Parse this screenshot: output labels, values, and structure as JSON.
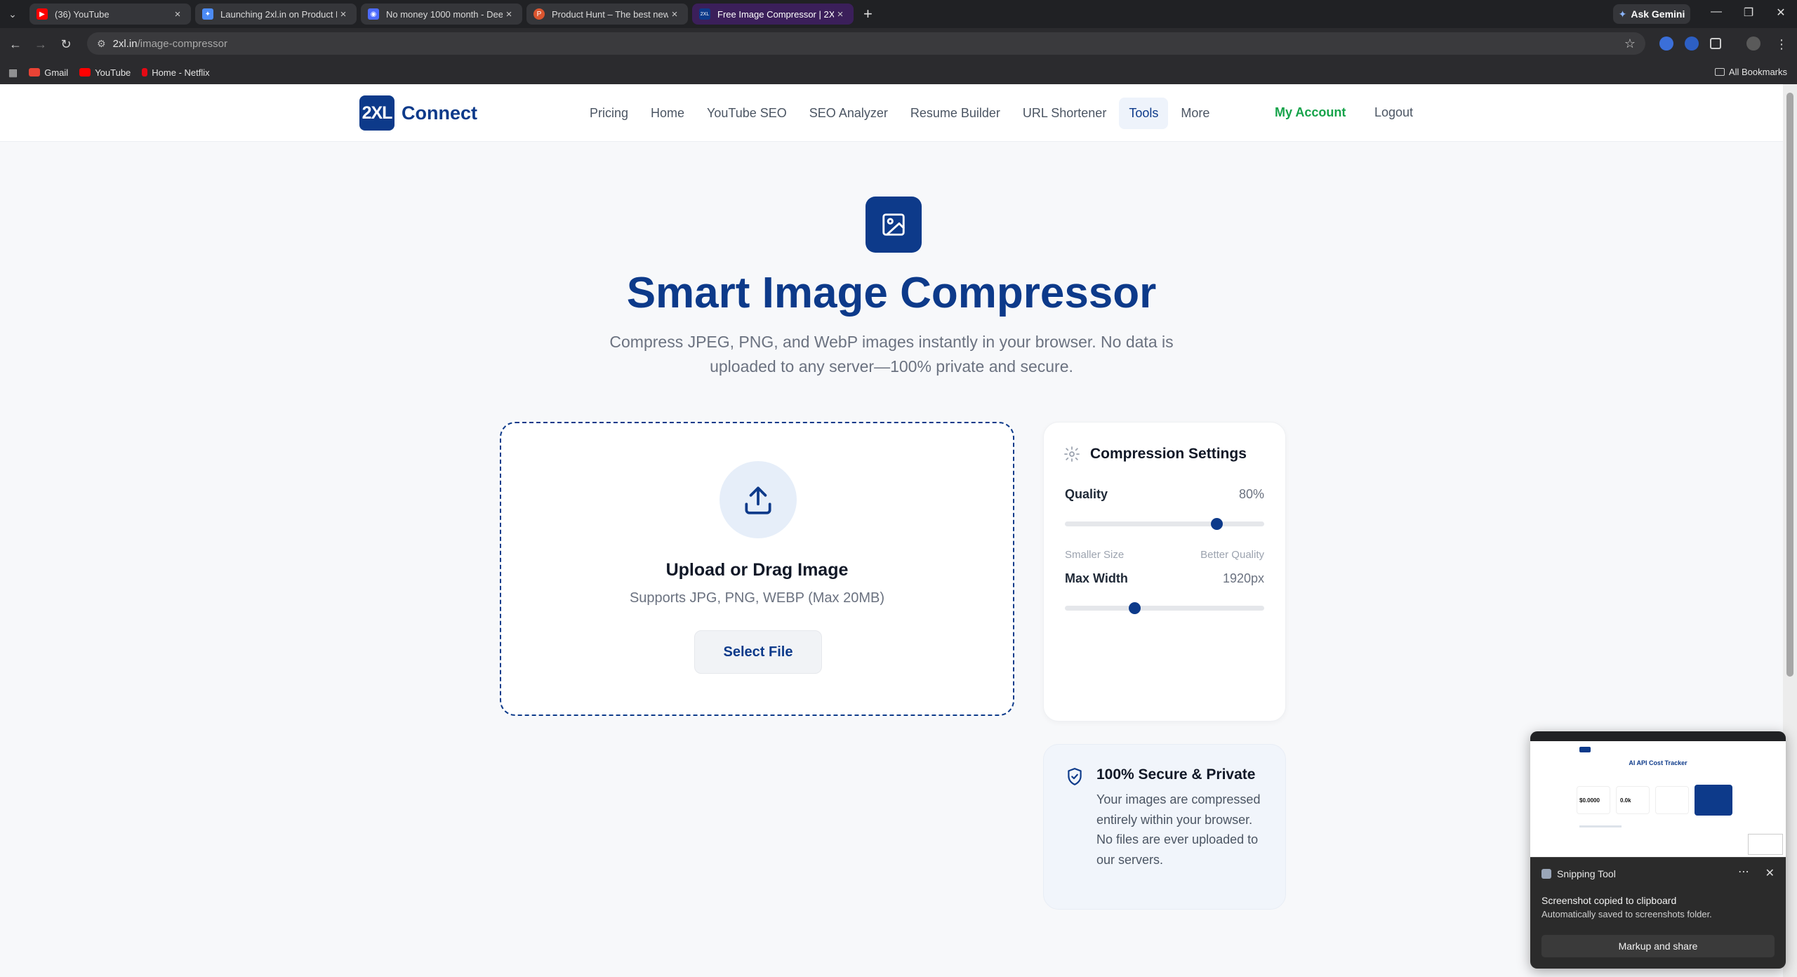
{
  "browser": {
    "tabs": [
      {
        "title": "(36) YouTube",
        "favicon_color": "#ff0000",
        "active": false
      },
      {
        "title": "Launching 2xl.in on Product Hu",
        "favicon_color": "#4c8bf5",
        "active": false
      },
      {
        "title": "No money 1000 month - Deep",
        "favicon_color": "#4d6bfe",
        "active": false
      },
      {
        "title": "Product Hunt – The best new p",
        "favicon_color": "#da552f",
        "active": false
      },
      {
        "title": "Free Image Compressor | 2XL",
        "favicon_color": "#0d3a8a",
        "active": true
      }
    ],
    "ask_gemini": "Ask Gemini",
    "url_host": "2xl.in",
    "url_path": "/image-compressor",
    "bookmarks": [
      {
        "label": "Gmail",
        "color": "#ea4335"
      },
      {
        "label": "YouTube",
        "color": "#ff0000"
      },
      {
        "label": "Home - Netflix",
        "color": "#e50914"
      }
    ],
    "all_bookmarks": "All Bookmarks"
  },
  "site": {
    "logo_badge": "2XL",
    "logo_text": "Connect",
    "nav": [
      "Pricing",
      "Home",
      "YouTube SEO",
      "SEO Analyzer",
      "Resume Builder",
      "URL Shortener",
      "Tools",
      "More"
    ],
    "active_nav": "Tools",
    "my_account": "My Account",
    "logout": "Logout"
  },
  "hero": {
    "icon": "image-icon",
    "title": "Smart Image Compressor",
    "subtitle": "Compress JPEG, PNG, and WebP images instantly in your browser. No data is uploaded to any server—100% private and secure."
  },
  "upload": {
    "icon": "upload-icon",
    "title": "Upload or Drag Image",
    "subtitle": "Supports JPG, PNG, WEBP (Max 20MB)",
    "button": "Select File"
  },
  "settings": {
    "title": "Compression Settings",
    "quality_label": "Quality",
    "quality_value": "80%",
    "quality_fraction": 0.76,
    "quality_min_label": "Smaller Size",
    "quality_max_label": "Better Quality",
    "max_width_label": "Max Width",
    "max_width_value": "1920px",
    "max_width_fraction": 0.35
  },
  "secure": {
    "icon": "shield-check-icon",
    "title": "100% Secure & Private",
    "text": "Your images are compressed entirely within your browser. No files are ever uploaded to our servers."
  },
  "toast": {
    "app": "Snipping Tool",
    "title": "Screenshot copied to clipboard",
    "subtitle": "Automatically saved to screenshots folder.",
    "button": "Markup and share",
    "preview": {
      "title": "AI API Cost Tracker",
      "stat1": "$0.0000",
      "stat2": "0.0k"
    }
  }
}
